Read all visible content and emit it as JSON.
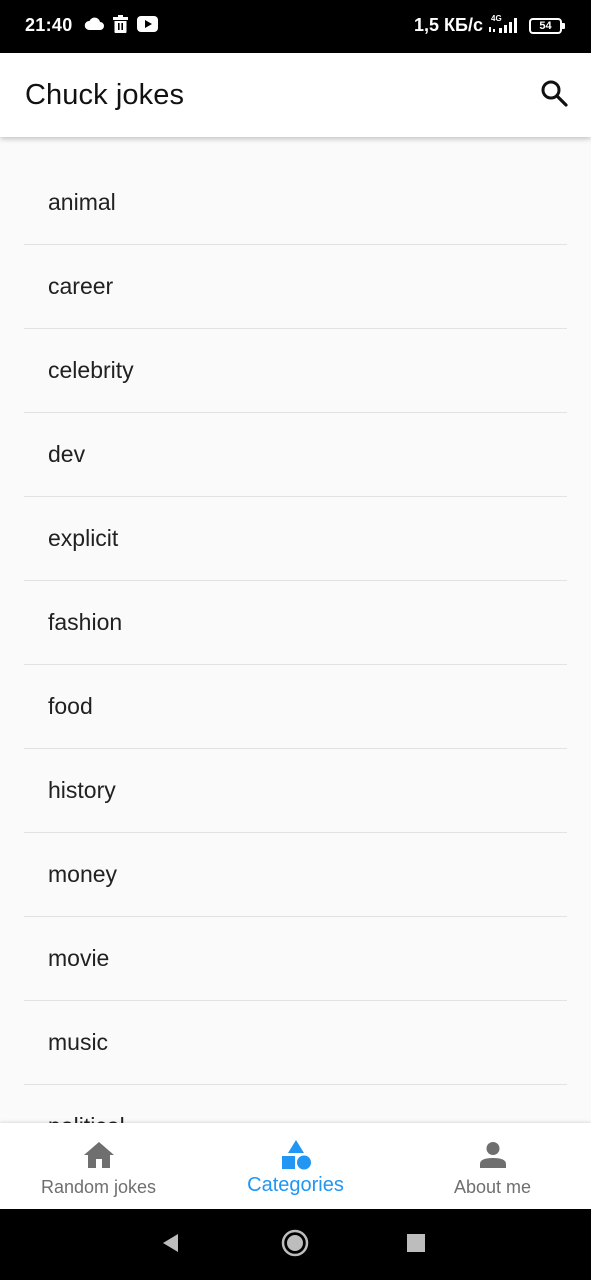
{
  "status_bar": {
    "time": "21:40",
    "network_speed": "1,5 КБ/с",
    "network_type": "4G",
    "battery_level": "54",
    "icons": [
      "cloud-icon",
      "trash-icon",
      "youtube-icon",
      "signal-icon",
      "battery-icon"
    ]
  },
  "app_bar": {
    "title": "Chuck jokes",
    "search_icon": "search-icon"
  },
  "categories": [
    "animal",
    "career",
    "celebrity",
    "dev",
    "explicit",
    "fashion",
    "food",
    "history",
    "money",
    "movie",
    "music",
    "political"
  ],
  "bottom_nav": {
    "items": [
      {
        "label": "Random jokes",
        "icon": "home-icon",
        "active": false
      },
      {
        "label": "Categories",
        "icon": "category-icon",
        "active": true
      },
      {
        "label": "About me",
        "icon": "person-icon",
        "active": false
      }
    ]
  },
  "system_nav": {
    "icons": [
      "back-icon",
      "home-icon",
      "recents-icon"
    ]
  },
  "colors": {
    "accent": "#2196f3",
    "inactive": "#6f6f6f",
    "text": "#212121",
    "background": "#fafafa",
    "divider": "#e3e3e3"
  }
}
